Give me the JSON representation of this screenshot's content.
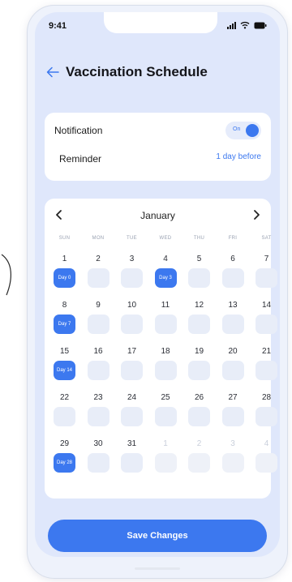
{
  "status_bar": {
    "time": "9:41",
    "icons": [
      "signal-icon",
      "wifi-icon",
      "battery-icon"
    ]
  },
  "header": {
    "back_icon": "back-arrow-icon",
    "title": "Vaccination Schedule"
  },
  "settings": {
    "notification_label": "Notification",
    "notification_toggle_text": "On",
    "notification_enabled": true,
    "reminder_label": "Reminder",
    "reminder_value": "1 day before"
  },
  "calendar": {
    "prev_icon": "chevron-left-icon",
    "next_icon": "chevron-right-icon",
    "month": "January",
    "weekdays": [
      "SUN",
      "MON",
      "TUE",
      "WED",
      "THU",
      "FRI",
      "SAT"
    ],
    "days": [
      {
        "n": "1",
        "vaccine": "Day 0"
      },
      {
        "n": "2"
      },
      {
        "n": "3"
      },
      {
        "n": "4",
        "vaccine": "Day 3"
      },
      {
        "n": "5"
      },
      {
        "n": "6"
      },
      {
        "n": "7"
      },
      {
        "n": "8",
        "vaccine": "Day 7"
      },
      {
        "n": "9"
      },
      {
        "n": "10"
      },
      {
        "n": "11"
      },
      {
        "n": "12"
      },
      {
        "n": "13"
      },
      {
        "n": "14"
      },
      {
        "n": "15",
        "vaccine": "Day 14"
      },
      {
        "n": "16"
      },
      {
        "n": "17"
      },
      {
        "n": "18"
      },
      {
        "n": "19"
      },
      {
        "n": "20"
      },
      {
        "n": "21"
      },
      {
        "n": "22"
      },
      {
        "n": "23"
      },
      {
        "n": "24"
      },
      {
        "n": "25"
      },
      {
        "n": "26"
      },
      {
        "n": "27"
      },
      {
        "n": "28"
      },
      {
        "n": "29",
        "vaccine": "Day 28"
      },
      {
        "n": "30"
      },
      {
        "n": "31"
      },
      {
        "n": "1",
        "muted": true
      },
      {
        "n": "2",
        "muted": true
      },
      {
        "n": "3",
        "muted": true
      },
      {
        "n": "4",
        "muted": true
      }
    ]
  },
  "save_button_label": "Save Changes",
  "colors": {
    "accent": "#3c78ef",
    "screen_background": "#dfe7fb",
    "card": "#ffffff",
    "slot": "#e8edf8"
  }
}
